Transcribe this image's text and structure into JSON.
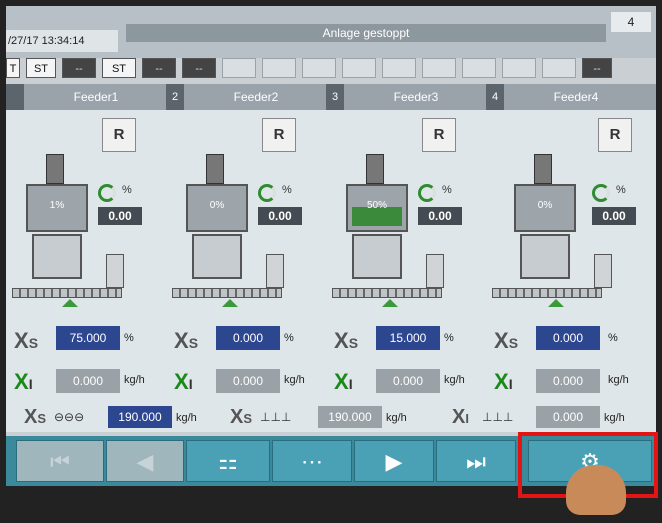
{
  "header": {
    "datetime": "/27/17 13:34:14",
    "status": "Anlage gestoppt",
    "page": "4",
    "modes": [
      "T",
      "ST",
      "--",
      "ST",
      "--",
      "--",
      "--"
    ]
  },
  "feeders": [
    {
      "num": "",
      "name": "Feeder1",
      "reset": "R",
      "fill_pct": "1%",
      "fill_level": 0.01,
      "pct_unit": "%",
      "pct_value": "0.00",
      "xs_value": "75.000",
      "xs_unit": "%",
      "xi_value": "0.000",
      "xi_unit": "kg/h"
    },
    {
      "num": "2",
      "name": "Feeder2",
      "reset": "R",
      "fill_pct": "0%",
      "fill_level": 0.0,
      "pct_unit": "%",
      "pct_value": "0.00",
      "xs_value": "0.000",
      "xs_unit": "%",
      "xi_value": "0.000",
      "xi_unit": "kg/h"
    },
    {
      "num": "3",
      "name": "Feeder3",
      "reset": "R",
      "fill_pct": "50%",
      "fill_level": 0.5,
      "pct_unit": "%",
      "pct_value": "0.00",
      "xs_value": "15.000",
      "xs_unit": "%",
      "xi_value": "0.000",
      "xi_unit": "kg/h"
    },
    {
      "num": "4",
      "name": "Feeder4",
      "reset": "R",
      "fill_pct": "0%",
      "fill_level": 0.0,
      "pct_unit": "%",
      "pct_value": "0.00",
      "xs_value": "0.000",
      "xs_unit": "%",
      "xi_value": "0.000",
      "xi_unit": "kg/h"
    }
  ],
  "labels": {
    "xs": "X",
    "xs_sub": "S",
    "xi": "X",
    "xi_sub": "I"
  },
  "totals": {
    "total_sp_value": "190.000",
    "total_sp_unit": "kg/h",
    "line_sp_value": "190.000",
    "line_sp_unit": "kg/h",
    "line_act_value": "0.000",
    "line_act_unit": "kg/h"
  },
  "nav": {
    "first": "⏮",
    "prev": "◀",
    "overview": "⚏",
    "trend": "⋯",
    "next": "▶",
    "last": "⏭",
    "settings": "⚙"
  },
  "colors": {
    "setpoint": "#2d4690",
    "actual": "#9aa1a7",
    "fill": "#3b8a3b",
    "nav": "#4aa1b5",
    "highlight": "#e31414"
  }
}
